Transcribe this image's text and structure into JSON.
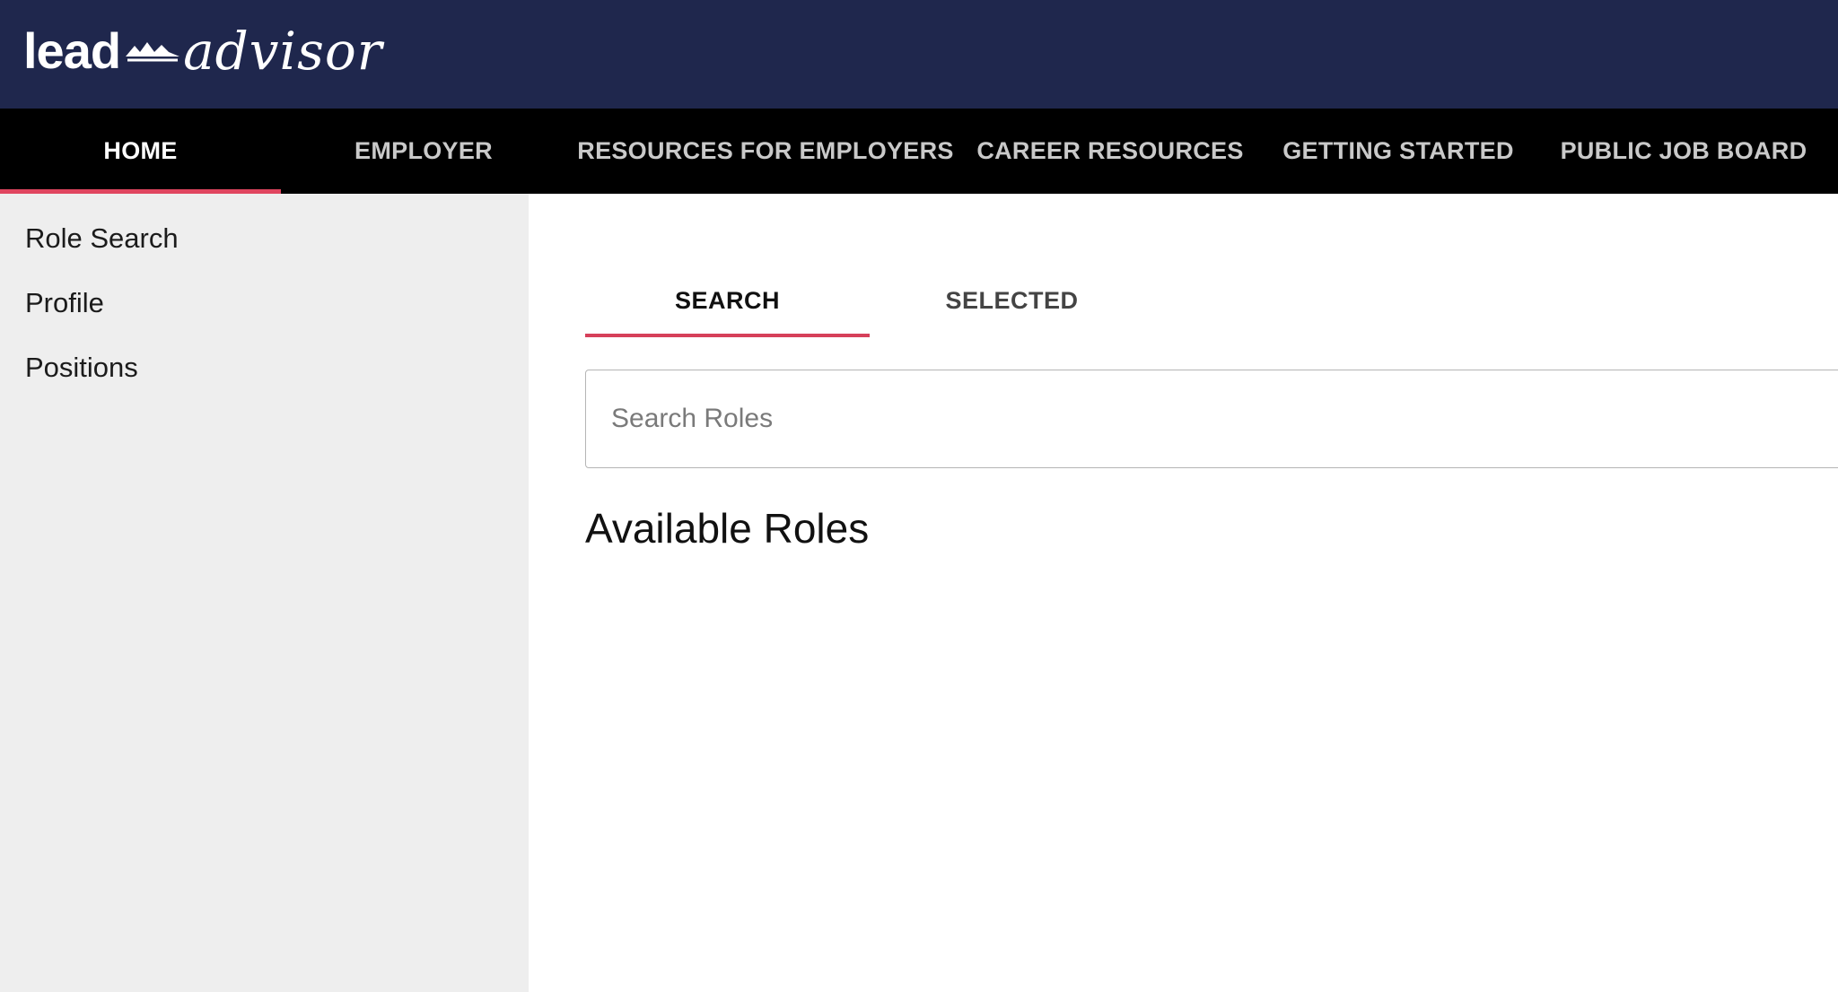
{
  "brand": {
    "logo_lead": "lead",
    "logo_advisor": "advisor"
  },
  "nav": {
    "items": [
      {
        "label": "HOME",
        "active": true
      },
      {
        "label": "EMPLOYER",
        "active": false
      },
      {
        "label": "RESOURCES FOR EMPLOYERS",
        "active": false
      },
      {
        "label": "CAREER RESOURCES",
        "active": false
      },
      {
        "label": "GETTING STARTED",
        "active": false
      },
      {
        "label": "PUBLIC JOB BOARD",
        "active": false
      }
    ]
  },
  "sidebar": {
    "items": [
      {
        "label": "Role Search"
      },
      {
        "label": "Profile"
      },
      {
        "label": "Positions"
      }
    ]
  },
  "main": {
    "tabs": [
      {
        "label": "SEARCH",
        "active": true
      },
      {
        "label": "SELECTED",
        "active": false
      }
    ],
    "search": {
      "placeholder": "Search Roles",
      "value": ""
    },
    "section_title": "Available Roles"
  },
  "colors": {
    "header_bg": "#1f274d",
    "nav_bg": "#000000",
    "accent": "#e0455f",
    "sidebar_bg": "#eeeeee"
  }
}
